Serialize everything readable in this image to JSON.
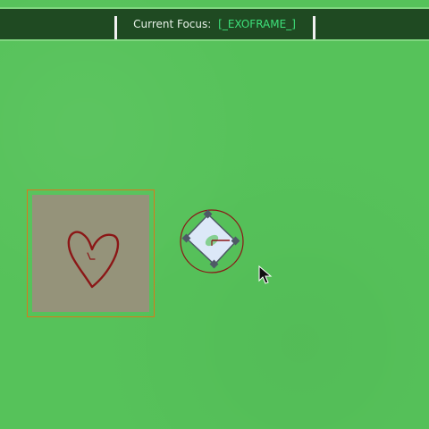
{
  "header": {
    "focus_label": "Current Focus:",
    "focus_value": "[_EXOFRAME_]"
  },
  "scene": {
    "background_color": "#56c25a",
    "header_color": "#1f4a22",
    "focus_accent": "#3ee07a"
  },
  "objects": [
    {
      "type": "card",
      "icon": "heart-icon"
    },
    {
      "type": "selected-token",
      "icon": "diamond-node-icon"
    },
    {
      "type": "cursor",
      "icon": "pointer-cursor-icon"
    }
  ]
}
